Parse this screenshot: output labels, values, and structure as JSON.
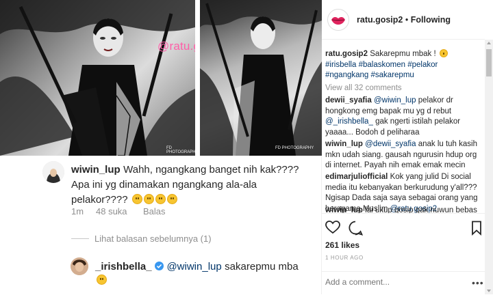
{
  "watermark": "@ratu.gosip2",
  "studio_label": "FD PHOTOGRAPHY",
  "main_comment": {
    "username": "wiwin_lup",
    "text": "Wahh, ngangkang banget nih kak???? Apa ini yg dinamakan ngangkang ala-ala pelakor????",
    "emoji_count": 4,
    "time": "1m",
    "likes": "48 suka",
    "reply": "Balas"
  },
  "view_replies": "Lihat balasan sebelumnya (1)",
  "reply_comment": {
    "username": "_irishbella_",
    "mention": "@wiwin_lup",
    "text": "sakarepmu mba",
    "verified_icon": "verified-badge-icon"
  },
  "post": {
    "account": "ratu.gosip2",
    "separator": "•",
    "follow_status": "Following",
    "caption_user": "ratu.gosip2",
    "caption_text": "Sakarepmu mbak !",
    "hashtags": [
      "#irisbella",
      "#balaskomen",
      "#pelakor",
      "#ngangkang",
      "#sakarepmu"
    ],
    "view_all": "View all 32 comments",
    "comments": [
      {
        "user": "dewii_syafia",
        "mention": "@wiwin_lup",
        "text": "pelakor dr hongkong emg bapak mu yg d rebut",
        "mention2": "@_irishbella_",
        "text2": "gak ngerti istilah pelakor yaaaa... Bodoh d peliharaa"
      },
      {
        "user": "wiwin_lup",
        "mention": "@dewii_syafia",
        "text": "anak lu tuh kasih mkn udah siang. gausah ngurusin hdup org di internet. Payah nih emak emak mecin"
      },
      {
        "user": "edimarjuliofficial",
        "text": "Kok yang julid Di social media itu kebanyakan berkurudung y'all??? Ngisap Dada saja saya sebagai orang yang beragama Muslim",
        "mention": "@ratu.gosip2"
      },
      {
        "user": "wiwin_lup",
        "text": "lai ukup gosip gak nuwun bebas"
      }
    ],
    "likes": "261 likes",
    "time": "1 HOUR AGO",
    "add_comment_placeholder": "Add a comment...",
    "more": "•••"
  }
}
